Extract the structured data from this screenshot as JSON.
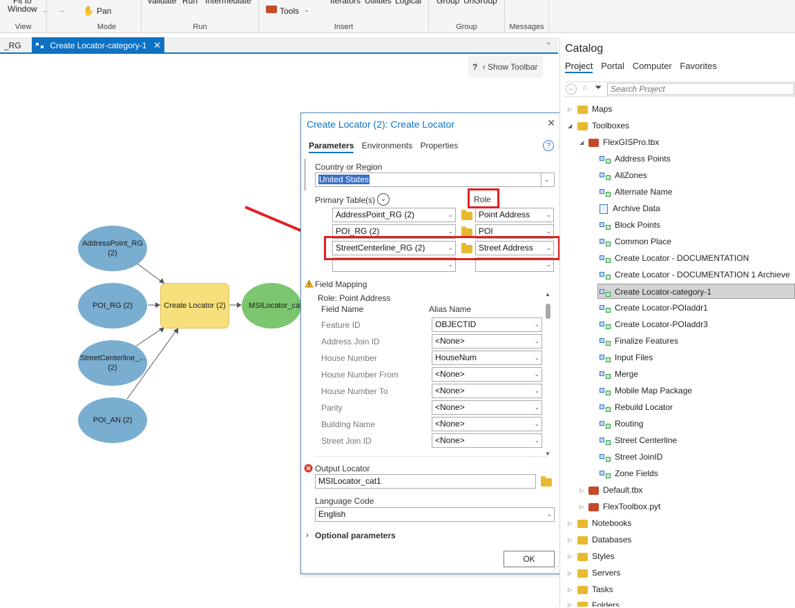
{
  "ribbon": {
    "fit_to": "Fit to",
    "window": "Window",
    "pan": "Pan",
    "validate": "Validate",
    "run": "Run",
    "intermediate": "Intermediate",
    "tools": "Tools",
    "iterators": "Iterators",
    "utilities": "Utilities",
    "logical": "Logical",
    "group": "Group",
    "ungroup": "UnGroup",
    "groups": [
      "View",
      "Mode",
      "Run",
      "Insert",
      "Group",
      "Messages"
    ]
  },
  "tabs": [
    {
      "label": "_RG",
      "active": false
    },
    {
      "label": "Create Locator-category-1",
      "active": true
    }
  ],
  "show_toolbar": "Show Toolbar",
  "model": {
    "inputs": [
      {
        "label": "AddressPoint_RG\n(2)"
      },
      {
        "label": "POI_RG (2)"
      },
      {
        "label": "StreetCenterline_...\n(2)"
      },
      {
        "label": "POI_AN (2)"
      }
    ],
    "tool": "Create Locator (2)",
    "output": "MSILocator_cat"
  },
  "dialog": {
    "title": "Create Locator (2): Create Locator",
    "tabs": [
      "Parameters",
      "Environments",
      "Properties"
    ],
    "country_label": "Country or Region",
    "country_value": "United States",
    "primary_tables_label": "Primary Table(s)",
    "role_label": "Role",
    "tables": [
      {
        "table": "AddressPoint_RG (2)",
        "role": "Point Address"
      },
      {
        "table": "POI_RG (2)",
        "role": "POI"
      },
      {
        "table": "StreetCenterline_RG (2)",
        "role": "Street Address"
      },
      {
        "table": "",
        "role": ""
      }
    ],
    "field_mapping_label": "Field Mapping",
    "role_point_address": "Role: Point Address",
    "field_name_header": "Field Name",
    "alias_name_header": "Alias Name",
    "field_rows": [
      {
        "field": "Feature ID",
        "alias": "OBJECTID"
      },
      {
        "field": "Address Join ID",
        "alias": "<None>"
      },
      {
        "field": "House Number",
        "alias": "HouseNum"
      },
      {
        "field": "House Number From",
        "alias": "<None>"
      },
      {
        "field": "House Number To",
        "alias": "<None>"
      },
      {
        "field": "Parity",
        "alias": "<None>"
      },
      {
        "field": "Building Name",
        "alias": "<None>"
      },
      {
        "field": "Street Join ID",
        "alias": "<None>"
      }
    ],
    "output_locator_label": "Output Locator",
    "output_locator_value": "MSILocator_cat1",
    "language_label": "Language Code",
    "language_value": "English",
    "optional_params": "Optional parameters",
    "ok_label": "OK"
  },
  "catalog": {
    "title": "Catalog",
    "tabs": [
      "Project",
      "Portal",
      "Computer",
      "Favorites"
    ],
    "search_placeholder": "Search Project",
    "tree": [
      {
        "label": "Maps"
      },
      {
        "label": "Toolboxes"
      },
      {
        "label": "FlexGISPro.tbx"
      },
      {
        "label": "Address Points"
      },
      {
        "label": "AllZones"
      },
      {
        "label": "Alternate Name"
      },
      {
        "label": "Archive Data"
      },
      {
        "label": "Block Points"
      },
      {
        "label": "Common Place"
      },
      {
        "label": "Create Locator - DOCUMENTATION"
      },
      {
        "label": "Create Locator - DOCUMENTATION 1 Archieve"
      },
      {
        "label": "Create Locator-category-1"
      },
      {
        "label": "Create Locator-POIaddr1"
      },
      {
        "label": "Create Locator-POIaddr3"
      },
      {
        "label": "Finalize Features"
      },
      {
        "label": "Input Files"
      },
      {
        "label": "Merge"
      },
      {
        "label": "Mobile Map Package"
      },
      {
        "label": "Rebuild Locator"
      },
      {
        "label": "Routing"
      },
      {
        "label": "Street Centerline"
      },
      {
        "label": "Street JoinID"
      },
      {
        "label": "Zone Fields"
      },
      {
        "label": "Default.tbx"
      },
      {
        "label": "FlexToolbox.pyt"
      },
      {
        "label": "Notebooks"
      },
      {
        "label": "Databases"
      },
      {
        "label": "Styles"
      },
      {
        "label": "Servers"
      },
      {
        "label": "Tasks"
      },
      {
        "label": "Folders"
      }
    ]
  },
  "colors": {
    "accent": "#0e72c4",
    "highlight": "#e02020"
  }
}
